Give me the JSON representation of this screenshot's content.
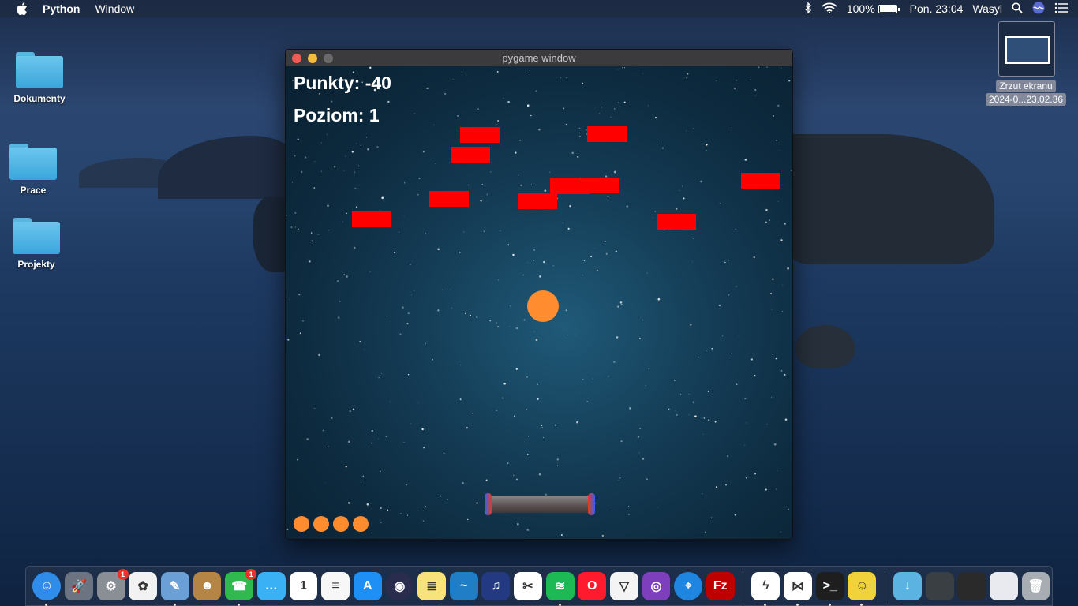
{
  "menubar": {
    "app_name": "Python",
    "menu_items": [
      "Window"
    ],
    "battery": "100%",
    "clock": "Pon. 23:04",
    "user": "Wasyl"
  },
  "desktop": {
    "icons": [
      {
        "label": "Dokumenty"
      },
      {
        "label": "Prace"
      },
      {
        "label": "Projekty"
      }
    ],
    "screenshot_thumb": {
      "line1": "Zrzut ekranu",
      "line2": "2024-0...23.02.36"
    }
  },
  "window": {
    "title": "pygame window"
  },
  "game": {
    "score_text": "Punkty: -40",
    "level_text": "Poziom: 1",
    "bricks_count": 11,
    "lives_remaining": 4,
    "colors": {
      "brick": "#ff0000",
      "ball": "#ff8c2e"
    }
  },
  "dock": {
    "apps": [
      {
        "name": "finder-icon",
        "color": "#2f8ce8",
        "glyph": "☺"
      },
      {
        "name": "launchpad-icon",
        "color": "#6b7480",
        "glyph": "🚀"
      },
      {
        "name": "system-preferences-icon",
        "color": "#8a8f96",
        "glyph": "⚙",
        "badge": "1"
      },
      {
        "name": "photos-icon",
        "color": "#f2f2f2",
        "glyph": "✿"
      },
      {
        "name": "preview-icon",
        "color": "#6aa0d6",
        "glyph": "✎"
      },
      {
        "name": "contacts-icon",
        "color": "#b58545",
        "glyph": "☻"
      },
      {
        "name": "facetime-icon",
        "color": "#2fb94e",
        "glyph": "☎",
        "badge": "1"
      },
      {
        "name": "messages-icon",
        "color": "#3ab1f5",
        "glyph": "…"
      },
      {
        "name": "calendar-icon",
        "color": "#ffffff",
        "glyph": "1"
      },
      {
        "name": "reminders-icon",
        "color": "#f7f7f7",
        "glyph": "≡"
      },
      {
        "name": "app-store-icon",
        "color": "#1e90f5",
        "glyph": "A"
      },
      {
        "name": "siri-icon",
        "color": "#2a2c4e",
        "glyph": "◉"
      },
      {
        "name": "notes-icon",
        "color": "#f8e27a",
        "glyph": "≣"
      },
      {
        "name": "openoffice-icon",
        "color": "#1f7ec6",
        "glyph": "~"
      },
      {
        "name": "audacity-icon",
        "color": "#233a82",
        "glyph": "♫"
      },
      {
        "name": "capcut-icon",
        "color": "#ffffff",
        "glyph": "✂"
      },
      {
        "name": "spotify-icon",
        "color": "#1db954",
        "glyph": "≋"
      },
      {
        "name": "opera-icon",
        "color": "#ff1b2d",
        "glyph": "O"
      },
      {
        "name": "proton-vpn-icon",
        "color": "#f4f4f4",
        "glyph": "▽"
      },
      {
        "name": "tor-browser-icon",
        "color": "#7d3fbc",
        "glyph": "◎"
      },
      {
        "name": "safari-icon",
        "color": "#1e86e0",
        "glyph": "⌖"
      },
      {
        "name": "filezilla-icon",
        "color": "#bf0000",
        "glyph": "Fz"
      },
      {
        "name": "messenger-icon",
        "color": "#ffffff",
        "glyph": "ϟ"
      },
      {
        "name": "vscode-icon",
        "color": "#ffffff",
        "glyph": "⋈"
      },
      {
        "name": "terminal-icon",
        "color": "#1e1e1e",
        "glyph": ">_"
      },
      {
        "name": "cyberduck-icon",
        "color": "#f0d23a",
        "glyph": "☺"
      },
      {
        "name": "downloads-folder-icon",
        "color": "#5ab3e0",
        "glyph": "↓"
      },
      {
        "name": "stack-recent-1-icon",
        "color": "#3a3f44",
        "glyph": ""
      },
      {
        "name": "stack-recent-2-icon",
        "color": "#2a2a2a",
        "glyph": ""
      },
      {
        "name": "stack-recent-3-icon",
        "color": "#e8eaef",
        "glyph": ""
      },
      {
        "name": "trash-icon",
        "color": "#a8adb4",
        "glyph": "🗑"
      }
    ]
  }
}
